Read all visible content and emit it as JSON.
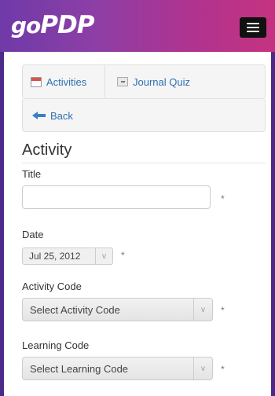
{
  "header": {
    "logo_go": "go",
    "logo_pdp": "PDP",
    "menu_icon": "hamburger-icon"
  },
  "nav": {
    "activities": {
      "label": "Activities",
      "icon": "calendar-icon"
    },
    "journal_quiz": {
      "label": "Journal Quiz",
      "icon": "document-icon"
    },
    "back": {
      "label": "Back",
      "icon": "back-arrow-icon"
    }
  },
  "form": {
    "section_title": "Activity",
    "title": {
      "label": "Title",
      "value": ""
    },
    "date": {
      "label": "Date",
      "value": "Jul 25, 2012",
      "caret": "v"
    },
    "activity_code": {
      "label": "Activity Code",
      "value": "Select Activity Code",
      "caret": "v"
    },
    "learning_code": {
      "label": "Learning Code",
      "value": "Select Learning Code",
      "caret": "v"
    },
    "required_mark": "*"
  },
  "colors": {
    "header_start": "#6f3aa8",
    "header_end": "#c53380",
    "link": "#2d6fb3",
    "frame": "#4b2a8a"
  }
}
